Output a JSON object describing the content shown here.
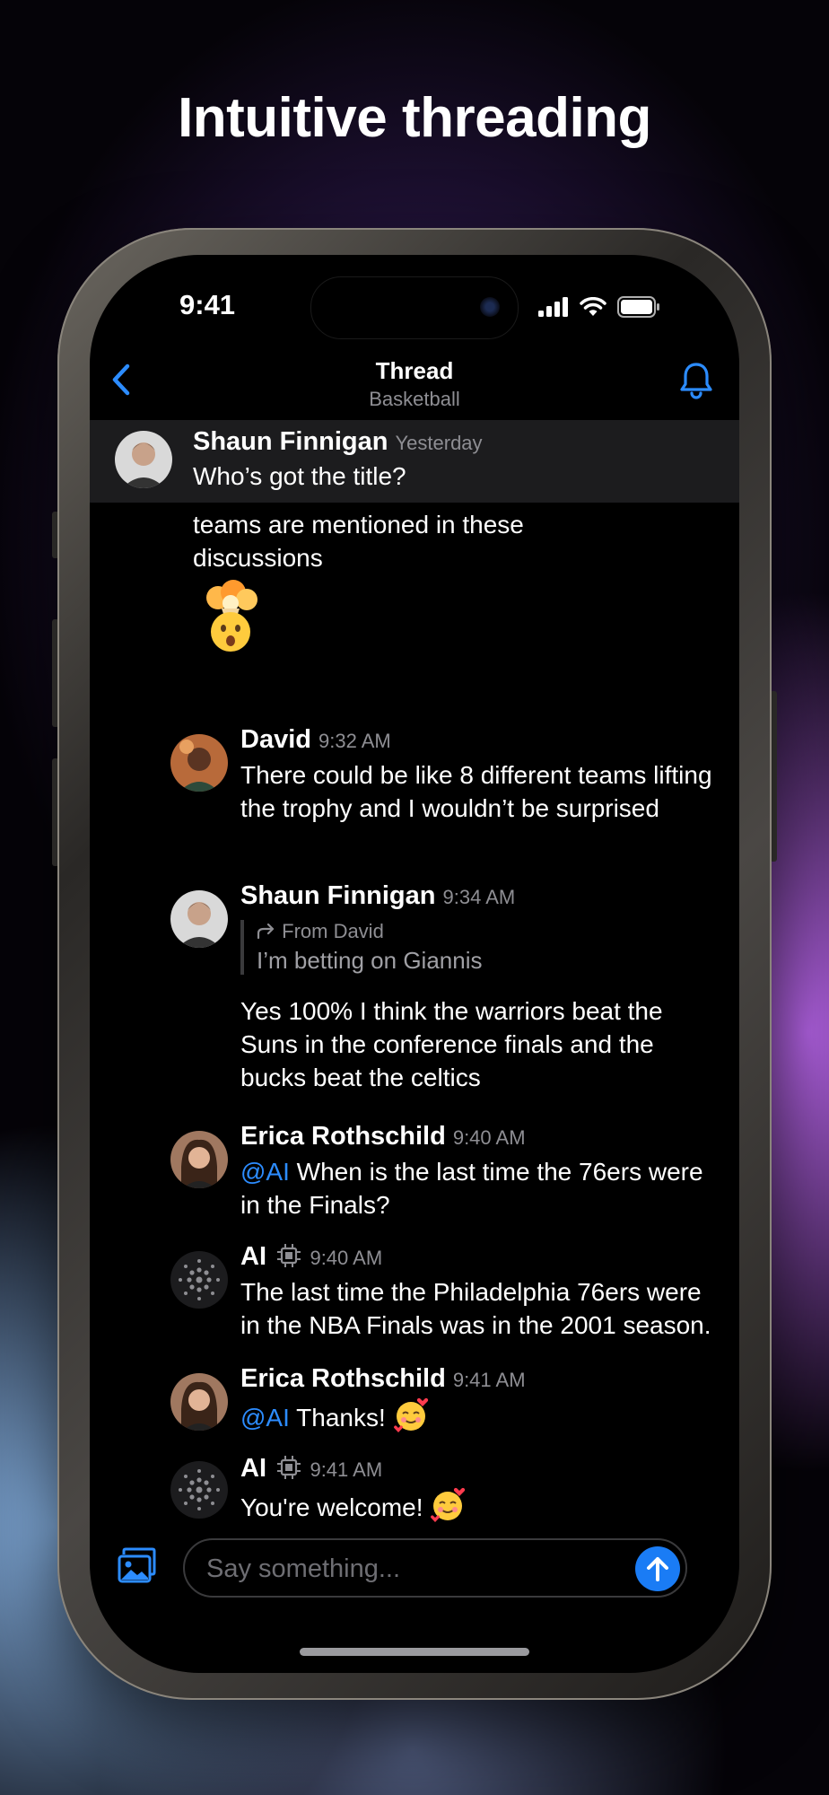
{
  "headline": "Intuitive threading",
  "status_bar": {
    "time": "9:41"
  },
  "header": {
    "title": "Thread",
    "subtitle": "Basketball"
  },
  "colors": {
    "accent": "#2c8cff",
    "background": "#000000",
    "secondary_text": "#8e8e93"
  },
  "pinned_message": {
    "author": "Shaun Finnigan",
    "time": "Yesterday",
    "text": "Who’s got the title?"
  },
  "partial_message": {
    "text": "teams are mentioned in these discussions",
    "emoji": "exploding-head-emoji"
  },
  "messages": [
    {
      "author": "David",
      "time": "9:32 AM",
      "text": "There could be like 8 different teams lifting the trophy and I wouldn’t be surprised"
    },
    {
      "author": "Shaun Finnigan",
      "time": "9:34 AM",
      "quote_from": "From David",
      "quote_text": "I’m betting on Giannis",
      "text": "Yes 100% I think the warriors beat the Suns in the conference finals and the bucks beat the celtics"
    },
    {
      "author": "Erica Rothschild",
      "time": "9:40 AM",
      "mention": "@AI",
      "text": " When is the last time the 76ers were in the Finals?"
    },
    {
      "author": "AI",
      "time": "9:40 AM",
      "text": "The last time the Philadelphia 76ers were in the NBA Finals was in the 2001 season."
    },
    {
      "author": "Erica Rothschild",
      "time": "9:41 AM",
      "mention": "@AI",
      "text": " Thanks!",
      "emoji": "smiling-face-with-hearts-emoji"
    },
    {
      "author": "AI",
      "time": "9:41 AM",
      "text": "You're welcome!",
      "emoji": "smiling-face-with-hearts-emoji"
    }
  ],
  "composer": {
    "placeholder": "Say something..."
  }
}
